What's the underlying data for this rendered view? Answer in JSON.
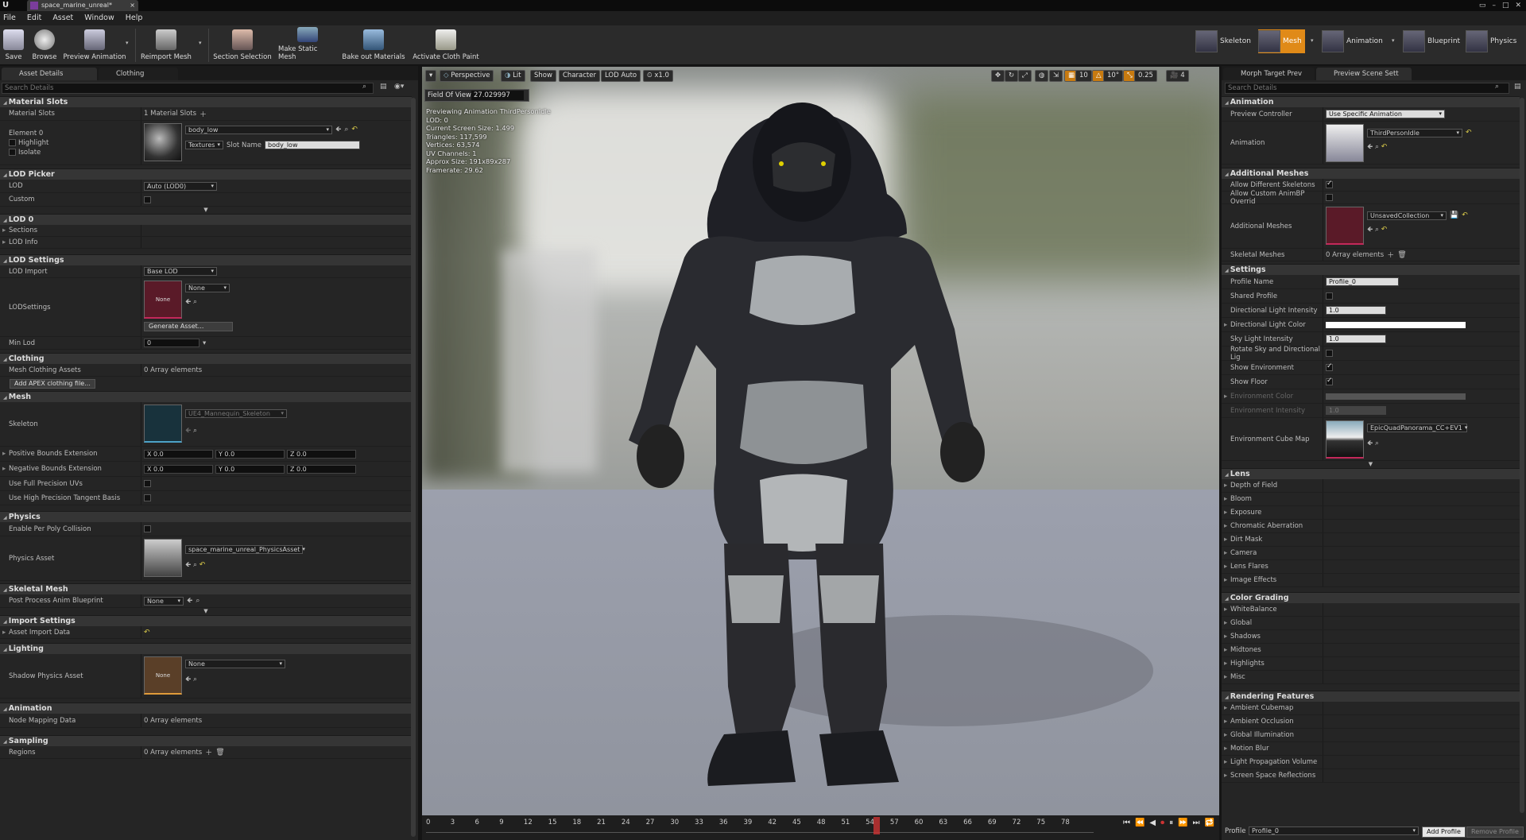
{
  "window": {
    "tab_title": "space_marine_unreal*",
    "controls": [
      "▭",
      "–",
      "□",
      "✕"
    ]
  },
  "menu": [
    "File",
    "Edit",
    "Asset",
    "Window",
    "Help"
  ],
  "toolbar": {
    "save": "Save",
    "browse": "Browse",
    "preview_animation": "Preview Animation",
    "reimport_mesh": "Reimport Mesh",
    "section_selection": "Section Selection",
    "make_static_mesh": "Make Static Mesh",
    "bake_out_materials": "Bake out Materials",
    "activate_cloth_paint": "Activate Cloth Paint"
  },
  "modes": {
    "skeleton": "Skeleton",
    "mesh": "Mesh",
    "animation": "Animation",
    "blueprint": "Blueprint",
    "physics": "Physics"
  },
  "left": {
    "tabs": [
      "Asset Details",
      "Clothing"
    ],
    "search_placeholder": "Search Details",
    "material_slots": {
      "header": "Material Slots",
      "label": "Material Slots",
      "count": "1 Material Slots",
      "element": "Element 0",
      "highlight": "Highlight",
      "isolate": "Isolate",
      "material": "body_low",
      "textures": "Textures",
      "slot_name_label": "Slot Name",
      "slot_name": "body_low"
    },
    "lod_picker": {
      "header": "LOD Picker",
      "lod_label": "LOD",
      "lod_value": "Auto (LOD0)",
      "custom": "Custom"
    },
    "lod0": {
      "header": "LOD 0",
      "sections": "Sections",
      "lod_info": "LOD Info"
    },
    "lod_settings": {
      "header": "LOD Settings",
      "lod_import": "LOD Import",
      "lod_import_value": "Base LOD",
      "lodsettings": "LODSettings",
      "thumb_text": "None",
      "asset_value": "None",
      "generate": "Generate Asset...",
      "min_lod": "Min Lod",
      "min_lod_value": "0"
    },
    "clothing": {
      "header": "Clothing",
      "mesh_clothing_assets": "Mesh Clothing Assets",
      "array": "0 Array elements",
      "add_apex": "Add APEX clothing file..."
    },
    "mesh": {
      "header": "Mesh",
      "skeleton": "Skeleton",
      "skeleton_value": "UE4_Mannequin_Skeleton",
      "pos_bounds": "Positive Bounds Extension",
      "neg_bounds": "Negative Bounds Extension",
      "x": "X 0.0",
      "y": "Y 0.0",
      "z": "Z 0.0",
      "full_precision": "Use Full Precision UVs",
      "high_precision": "Use High Precision Tangent Basis"
    },
    "physics": {
      "header": "Physics",
      "per_poly": "Enable Per Poly Collision",
      "physics_asset": "Physics Asset",
      "physics_asset_value": "space_marine_unreal_PhysicsAsset"
    },
    "skeletal_mesh": {
      "header": "Skeletal Mesh",
      "post_process": "Post Process Anim Blueprint",
      "value": "None"
    },
    "import_settings": {
      "header": "Import Settings",
      "asset_import_data": "Asset Import Data"
    },
    "lighting": {
      "header": "Lighting",
      "shadow_physics": "Shadow Physics Asset",
      "thumb_text": "None",
      "value": "None"
    },
    "animation": {
      "header": "Animation",
      "node_mapping": "Node Mapping Data",
      "array": "0 Array elements"
    },
    "sampling": {
      "header": "Sampling",
      "regions": "Regions",
      "array": "0 Array elements"
    }
  },
  "viewport": {
    "perspective": "Perspective",
    "lit": "Lit",
    "show": "Show",
    "character": "Character",
    "lod_auto": "LOD Auto",
    "speed": "x1.0",
    "grid": "10",
    "angle": "10°",
    "scale": "0.25",
    "cam_speed": "4",
    "fov_label": "Field Of View",
    "fov_value": "27.029997",
    "stats": [
      "Previewing Animation ThirdPersonIdle",
      "LOD: 0",
      "Current Screen Size: 1.499",
      "Triangles: 117,599",
      "Vertices: 63,574",
      "UV Channels: 1",
      "Approx Size: 191x89x287",
      "Framerate: 29.62"
    ]
  },
  "timeline": {
    "ticks": [
      "0",
      "3",
      "6",
      "9",
      "12",
      "15",
      "18",
      "21",
      "24",
      "27",
      "30",
      "33",
      "36",
      "39",
      "42",
      "45",
      "48",
      "51",
      "54",
      "57",
      "60",
      "63",
      "66",
      "69",
      "72",
      "75",
      "78"
    ],
    "playhead": "55"
  },
  "right": {
    "tabs": [
      "Morph Target Prev",
      "Preview Scene Sett"
    ],
    "search_placeholder": "Search Details",
    "animation": {
      "header": "Animation",
      "preview_controller": "Preview Controller",
      "controller_value": "Use Specific Animation",
      "animation": "Animation",
      "animation_value": "ThirdPersonIdle"
    },
    "additional_meshes": {
      "header": "Additional Meshes",
      "allow_diff": "Allow Different Skeletons",
      "allow_custom": "Allow Custom AnimBP Overrid",
      "additional": "Additional Meshes",
      "collection": "UnsavedCollection",
      "skeletal_meshes": "Skeletal Meshes",
      "array": "0 Array elements"
    },
    "settings": {
      "header": "Settings",
      "profile_name": "Profile Name",
      "profile_value": "Profile_0",
      "shared": "Shared Profile",
      "dir_intensity": "Directional Light Intensity",
      "dir_intensity_value": "1.0",
      "dir_color": "Directional Light Color",
      "sky_intensity": "Sky Light Intensity",
      "sky_intensity_value": "1.0",
      "rotate": "Rotate Sky and Directional Lig",
      "show_env": "Show Environment",
      "show_floor": "Show Floor",
      "env_color": "Environment Color",
      "env_intensity": "Environment Intensity",
      "env_intensity_value": "1.0",
      "cube_map": "Environment Cube Map",
      "cube_value": "EpicQuadPanorama_CC+EV1"
    },
    "lens": {
      "header": "Lens",
      "items": [
        "Depth of Field",
        "Bloom",
        "Exposure",
        "Chromatic Aberration",
        "Dirt Mask",
        "Camera",
        "Lens Flares",
        "Image Effects"
      ]
    },
    "color_grading": {
      "header": "Color Grading",
      "items": [
        "WhiteBalance",
        "Global",
        "Shadows",
        "Midtones",
        "Highlights",
        "Misc"
      ]
    },
    "rendering": {
      "header": "Rendering Features",
      "items": [
        "Ambient Cubemap",
        "Ambient Occlusion",
        "Global Illumination",
        "Motion Blur",
        "Light Propagation Volume",
        "Screen Space Reflections"
      ]
    },
    "footer": {
      "profile_label": "Profile",
      "profile_value": "Profile_0",
      "add": "Add Profile",
      "remove": "Remove Profile"
    }
  }
}
